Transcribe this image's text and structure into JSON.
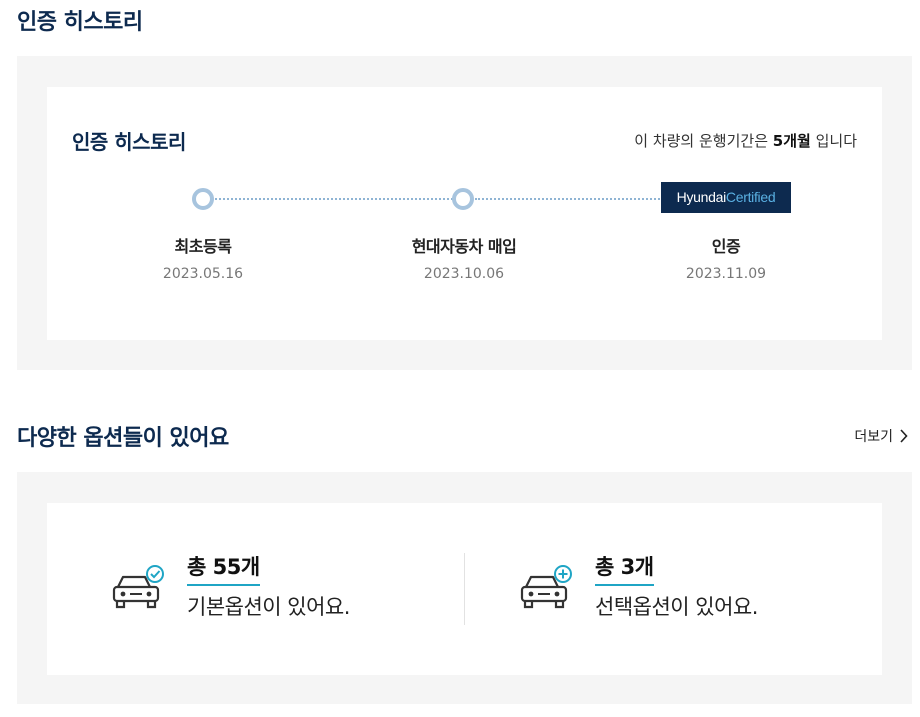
{
  "page_title": "인증 히스토리",
  "history": {
    "title": "인증 히스토리",
    "period_prefix": "이 차량의 운행기간은 ",
    "period_value": "5개월",
    "period_suffix": " 입니다",
    "badge_main": "Hyundai",
    "badge_sub": "Certified",
    "steps": [
      {
        "label": "최초등록",
        "date": "2023.05.16"
      },
      {
        "label": "현대자동차 매입",
        "date": "2023.10.06"
      },
      {
        "label": "인증",
        "date": "2023.11.09"
      }
    ]
  },
  "options": {
    "title": "다양한 옵션들이 있어요",
    "more_label": "더보기",
    "items": [
      {
        "count": "총 55개",
        "desc": "기본옵션이 있어요.",
        "icon": "car-check-icon"
      },
      {
        "count": "총 3개",
        "desc": "선택옵션이 있어요.",
        "icon": "car-plus-icon"
      }
    ]
  },
  "colors": {
    "navy": "#0d2a4f",
    "accent": "#1fa5c5",
    "dot": "#a7c4de",
    "panel_bg": "#f5f5f5"
  }
}
